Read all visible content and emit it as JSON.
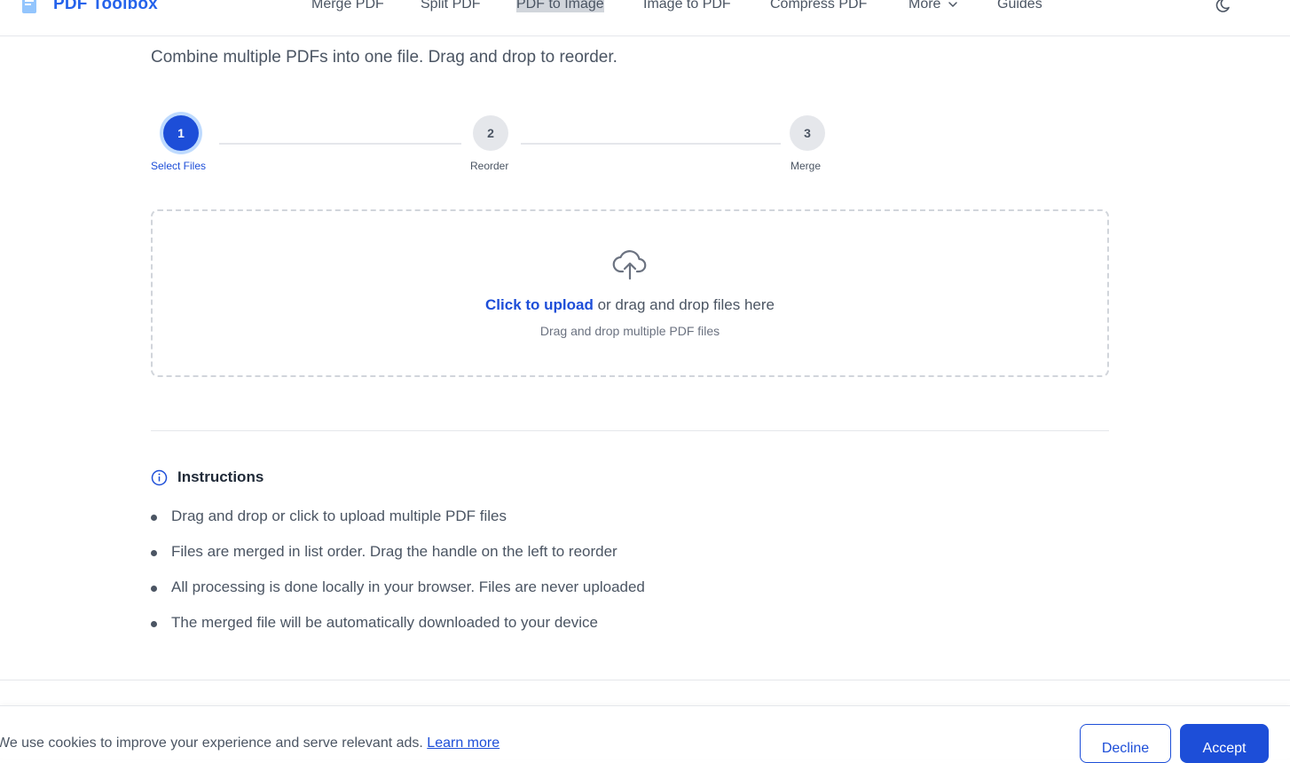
{
  "header": {
    "logo_text": "PDF Toolbox",
    "nav": [
      {
        "label": "Merge PDF"
      },
      {
        "label": "Split PDF"
      },
      {
        "label": "PDF to Image"
      },
      {
        "label": "Image to PDF"
      },
      {
        "label": "Compress PDF"
      },
      {
        "label": "More"
      },
      {
        "label": "Guides"
      }
    ]
  },
  "page": {
    "subtitle": "Combine multiple PDFs into one file. Drag and drop to reorder."
  },
  "stepper": {
    "steps": [
      {
        "number": "1",
        "label": "Select Files",
        "state": "active"
      },
      {
        "number": "2",
        "label": "Reorder",
        "state": "inactive"
      },
      {
        "number": "3",
        "label": "Merge",
        "state": "inactive"
      }
    ]
  },
  "dropzone": {
    "link_text": "Click to upload",
    "main_text": " or drag and drop files here",
    "sub_text": "Drag and drop multiple PDF files",
    "icon": "cloud-upload-icon"
  },
  "instructions": {
    "title": "Instructions",
    "icon": "info-icon",
    "items": [
      "Drag and drop or click to upload multiple PDF files",
      "Files are merged in list order. Drag the handle on the left to reorder",
      "All processing is done locally in your browser. Files are never uploaded",
      "The merged file will be automatically downloaded to your device"
    ]
  },
  "cookie_banner": {
    "text": "We use cookies to improve your experience and serve relevant ads.",
    "link_text": "Learn more",
    "decline_label": "Decline",
    "accept_label": "Accept"
  },
  "colors": {
    "primary": "#1d4ed8",
    "accent_ring": "#bfdbfe",
    "muted_text": "#4b5563",
    "border": "#e5e7eb"
  }
}
